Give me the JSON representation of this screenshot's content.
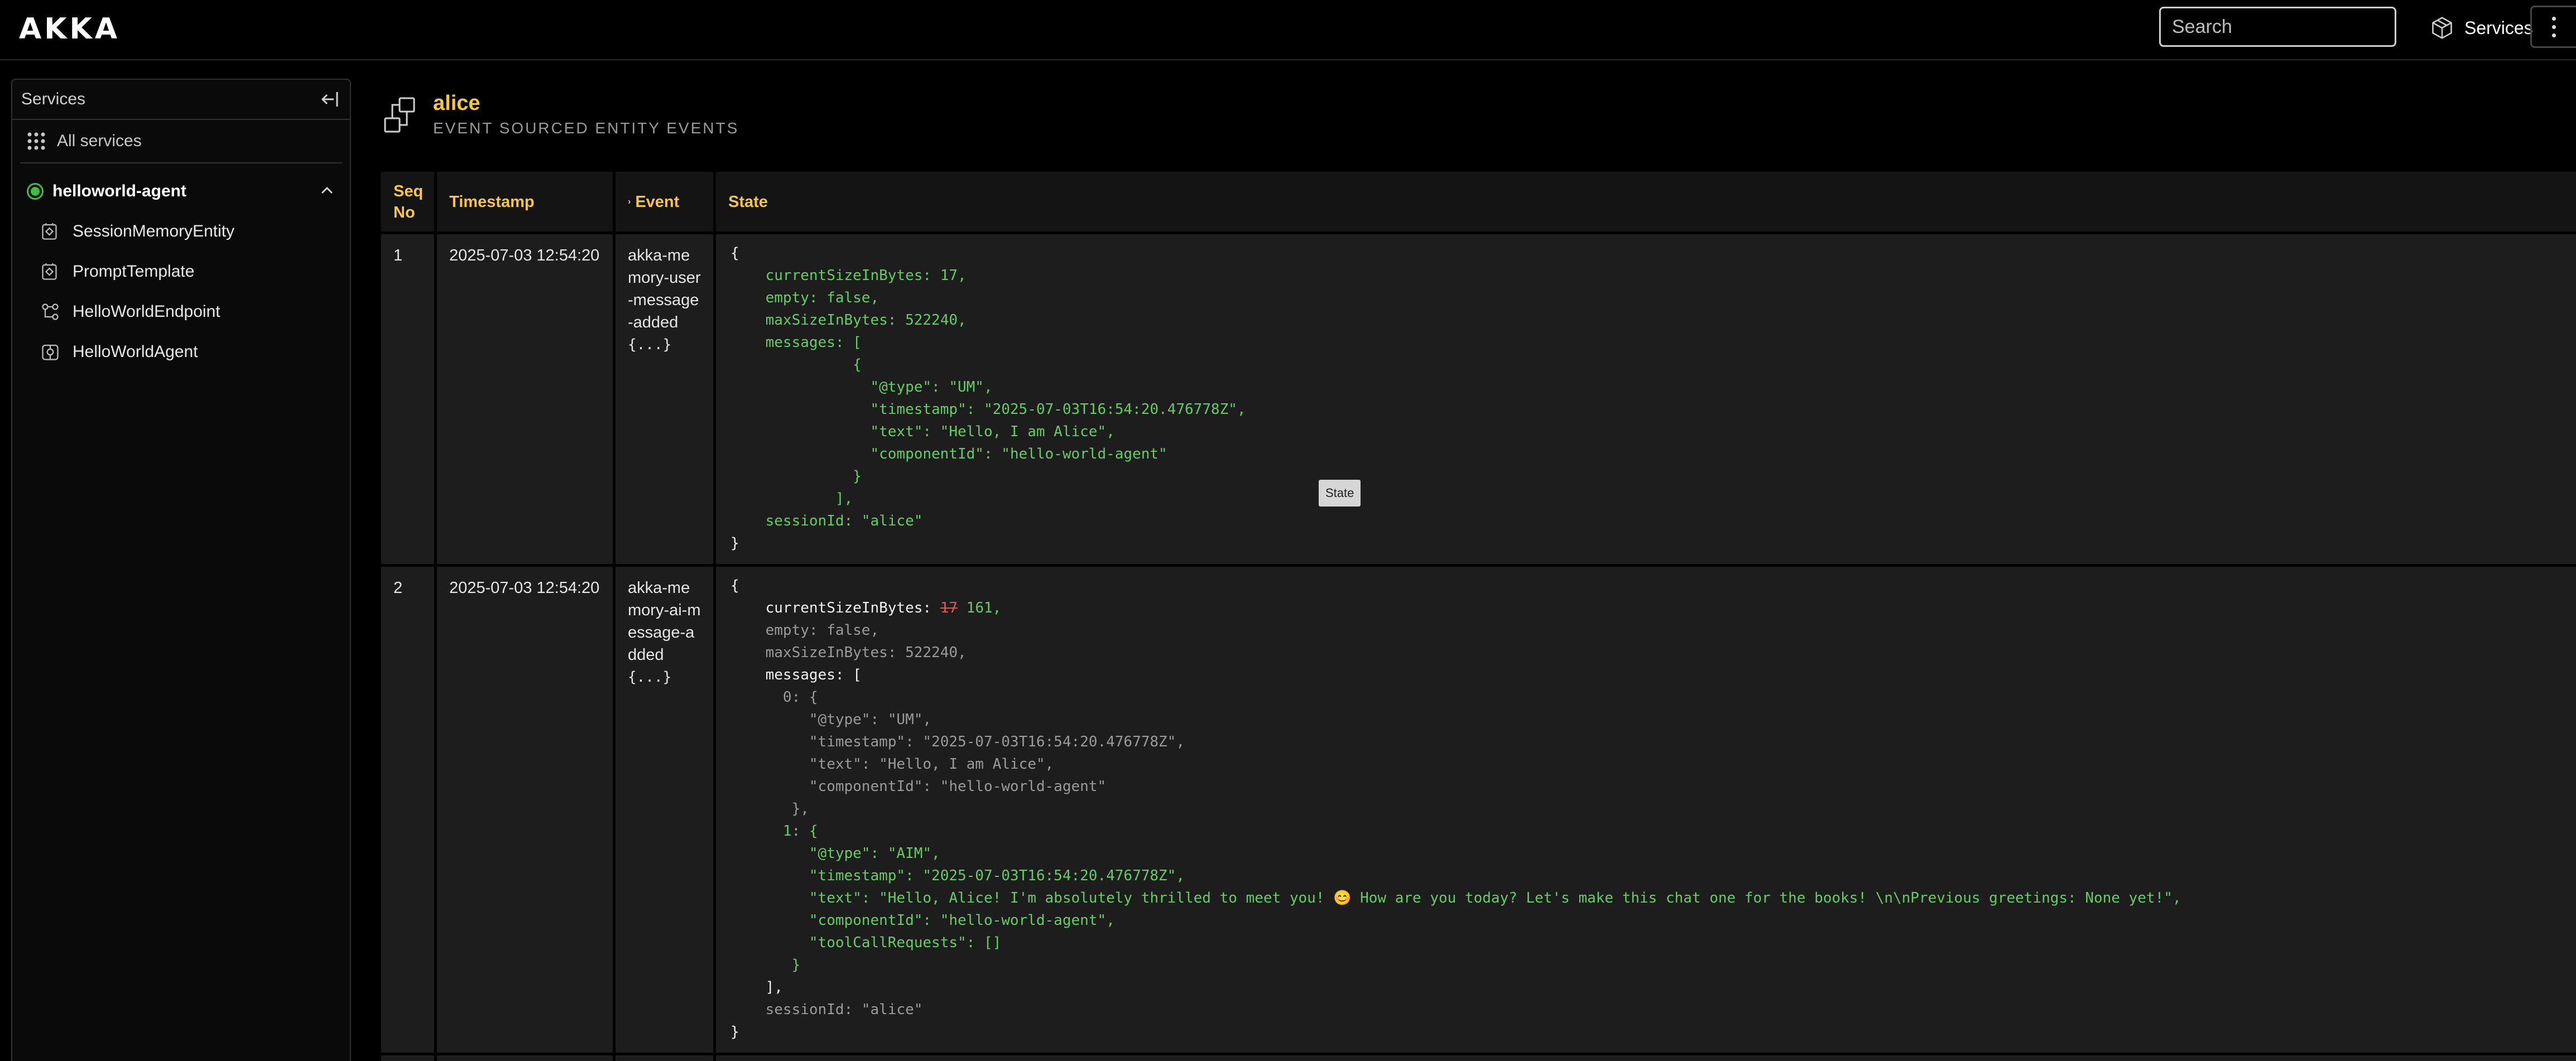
{
  "header": {
    "logo": "AKKA",
    "search_placeholder": "Search",
    "services_label": "Services"
  },
  "sidebar": {
    "title": "Services",
    "all_services": "All services",
    "service": {
      "name": "helloworld-agent",
      "status": "running"
    },
    "items": [
      {
        "label": "SessionMemoryEntity",
        "icon": "entity-icon"
      },
      {
        "label": "PromptTemplate",
        "icon": "entity-icon"
      },
      {
        "label": "HelloWorldEndpoint",
        "icon": "endpoint-icon"
      },
      {
        "label": "HelloWorldAgent",
        "icon": "agent-icon"
      }
    ]
  },
  "entity": {
    "title": "alice",
    "subtitle": "EVENT SOURCED ENTITY EVENTS"
  },
  "table": {
    "headers": [
      "Seq No",
      "Timestamp",
      "Event",
      "State"
    ],
    "tooltip": "State",
    "rows": [
      {
        "seq": "1",
        "timestamp": "2025-07-03 12:54:20",
        "event": "akka-memory-user-message-added",
        "event_expand": "{...}"
      },
      {
        "seq": "2",
        "timestamp": "2025-07-03 12:54:20",
        "event": "akka-memory-ai-message-added",
        "event_expand": "{...}"
      }
    ]
  },
  "state1": {
    "open": "{",
    "l1": "currentSizeInBytes: 17,",
    "l2": "empty: false,",
    "l3": "maxSizeInBytes: 522240,",
    "l4": "messages: [",
    "l5": "{",
    "l6": "\"@type\": \"UM\",",
    "l7": "\"timestamp\": \"2025-07-03T16:54:20.476778Z\",",
    "l8": "\"text\": \"Hello, I am Alice\",",
    "l9": "\"componentId\": \"hello-world-agent\"",
    "l10": "}",
    "l11": "],",
    "l12": "sessionId: \"alice\"",
    "close": "}"
  },
  "state2": {
    "open": "{",
    "size_key": "currentSizeInBytes: ",
    "size_old": "17",
    "size_new": " 161,",
    "l2": "empty: false,",
    "l3": "maxSizeInBytes: 522240,",
    "l4": "messages: [",
    "m0_open": "0: {",
    "m0_type": "\"@type\": \"UM\",",
    "m0_ts": "\"timestamp\": \"2025-07-03T16:54:20.476778Z\",",
    "m0_text": "\"text\": \"Hello, I am Alice\",",
    "m0_comp": "\"componentId\": \"hello-world-agent\"",
    "m0_close": "},",
    "m1_open": "1: {",
    "m1_type": "\"@type\": \"AIM\",",
    "m1_ts": "\"timestamp\": \"2025-07-03T16:54:20.476778Z\",",
    "m1_text": "\"text\": \"Hello, Alice! I'm absolutely thrilled to meet you! 😊 How are you today? Let's make this chat one for the books! \\n\\nPrevious greetings: None yet!\",",
    "m1_comp": "\"componentId\": \"hello-world-agent\",",
    "m1_tools": "\"toolCallRequests\": []",
    "m1_close": "}",
    "l11": "],",
    "l12": "sessionId: \"alice\"",
    "close": "}"
  }
}
